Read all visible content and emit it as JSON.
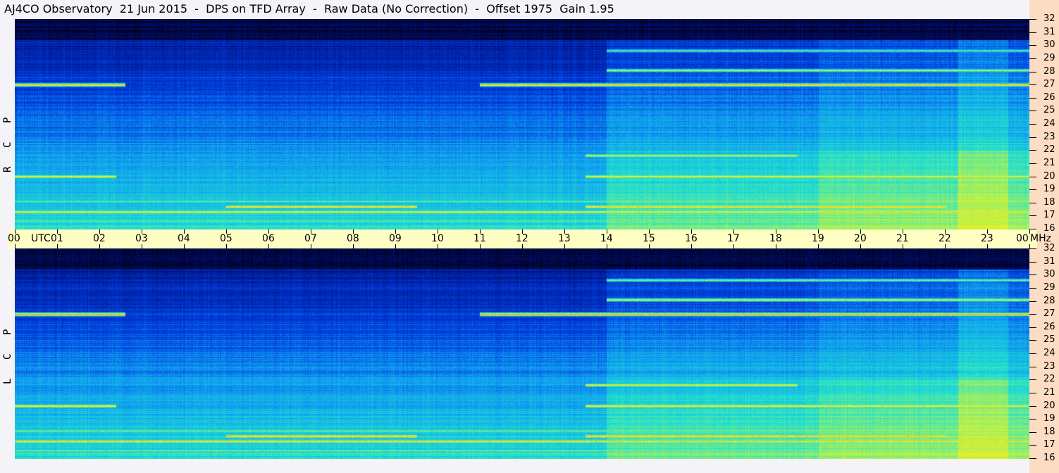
{
  "title": "AJ4CO Observatory  21 Jun 2015  -  DPS on TFD Array  -  Raw Data (No Correction)  -  Offset 1975  Gain 1.95",
  "panels": [
    {
      "label": "R C P",
      "letters": [
        "R",
        "C",
        "P"
      ]
    },
    {
      "label": "L C P",
      "letters": [
        "L",
        "C",
        "P"
      ]
    }
  ],
  "time_axis": {
    "unit_label": "UTC",
    "end_unit": "MHz",
    "ticks": [
      "00",
      "01",
      "02",
      "03",
      "04",
      "05",
      "06",
      "07",
      "08",
      "09",
      "10",
      "11",
      "12",
      "13",
      "14",
      "15",
      "16",
      "17",
      "18",
      "19",
      "20",
      "21",
      "22",
      "23",
      "00"
    ]
  },
  "freq_axis": {
    "ticks": [
      "32",
      "31",
      "30",
      "29",
      "28",
      "27",
      "26",
      "25",
      "24",
      "23",
      "22",
      "21",
      "20",
      "19",
      "18",
      "17",
      "16"
    ]
  },
  "chart_data": {
    "type": "heatmap",
    "title": "AJ4CO Observatory 21 Jun 2015 - DPS on TFD Array - Raw Data (No Correction) - Offset 1975 Gain 1.95",
    "xlabel": "UTC",
    "ylabel": "MHz",
    "xlim": [
      0,
      24
    ],
    "ylim": [
      16,
      32
    ],
    "colormap": [
      "#000010",
      "#001080",
      "#0040e0",
      "#10a0f0",
      "#20e0d0",
      "#a0f060",
      "#f0f020",
      "#ff9020",
      "#ff30c0"
    ],
    "daytime_enhancement_hours": [
      14,
      24
    ],
    "interference_bands": [
      {
        "mhz": 27.0,
        "hours": [
          [
            0,
            2.6
          ],
          [
            11,
            24
          ]
        ],
        "level": 0.85
      },
      {
        "mhz": 28.1,
        "hours": [
          [
            14,
            24
          ]
        ],
        "level": 0.7
      },
      {
        "mhz": 29.6,
        "hours": [
          [
            14,
            24
          ]
        ],
        "level": 0.6
      },
      {
        "mhz": 21.6,
        "hours": [
          [
            13.5,
            18.5
          ]
        ],
        "level": 0.75
      },
      {
        "mhz": 20.0,
        "hours": [
          [
            0,
            2.4
          ],
          [
            13.5,
            24
          ]
        ],
        "level": 0.8
      },
      {
        "mhz": 18.1,
        "hours": [
          [
            0,
            24
          ]
        ],
        "level": 0.6
      },
      {
        "mhz": 17.7,
        "hours": [
          [
            5,
            9.5
          ],
          [
            13.5,
            22
          ]
        ],
        "level": 0.85
      },
      {
        "mhz": 17.3,
        "hours": [
          [
            0,
            24
          ]
        ],
        "level": 0.8
      },
      {
        "mhz": 16.6,
        "hours": [
          [
            0,
            24
          ]
        ],
        "level": 0.6
      }
    ]
  }
}
